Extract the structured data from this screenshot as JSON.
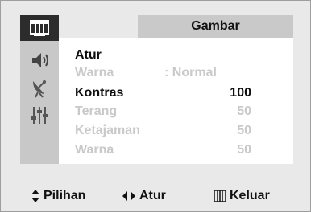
{
  "header": {
    "title": "Gambar"
  },
  "sidebar": {
    "icons": [
      {
        "icon": "picture-icon",
        "selected": true
      },
      {
        "icon": "speaker-icon",
        "selected": false
      },
      {
        "icon": "satellite-dish-icon",
        "selected": false
      },
      {
        "icon": "equalizer-icon",
        "selected": false
      }
    ]
  },
  "menu": {
    "items": [
      {
        "label": "Atur",
        "value": "",
        "state": "active"
      },
      {
        "label": "Warna",
        "value": ": Normal",
        "state": "disabled"
      },
      {
        "label": "Kontras",
        "value": "100",
        "state": "active"
      },
      {
        "label": "Terang",
        "value": "50",
        "state": "disabled"
      },
      {
        "label": "Ketajaman",
        "value": "50",
        "state": "disabled"
      },
      {
        "label": "Warna",
        "value": "50",
        "state": "disabled"
      }
    ]
  },
  "help": {
    "select_label": "Pilihan",
    "adjust_label": "Atur",
    "exit_label": "Keluar"
  },
  "colors": {
    "panel": "#ffffff",
    "sidebar": "#c8c8c8",
    "selected_icon_bg": "#2c2c2c",
    "dim_text": "#c9c9c9",
    "background": "#e9e9e9"
  }
}
